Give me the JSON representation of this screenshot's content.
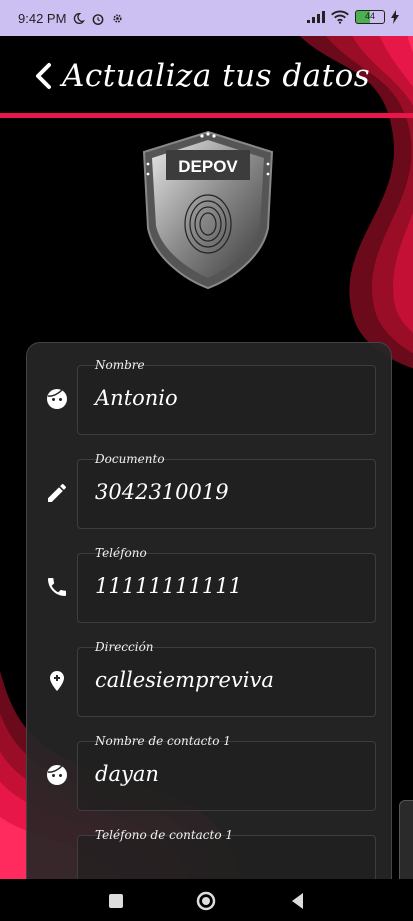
{
  "status_bar": {
    "time": "9:42 PM",
    "icons": [
      "moon-icon",
      "alarm-icon",
      "settings-icon",
      "signal-icon",
      "wifi-icon",
      "battery-icon",
      "charging-icon"
    ],
    "battery_level": "44"
  },
  "header": {
    "title": "Actualiza tus datos",
    "back_icon": "chevron-left-icon"
  },
  "logo": {
    "text": "DEPOV"
  },
  "form": {
    "fields": [
      {
        "label": "Nombre",
        "value": "Antonio",
        "icon": "face-icon"
      },
      {
        "label": "Documento",
        "value": "3042310019",
        "icon": "pencil-icon"
      },
      {
        "label": "Teléfono",
        "value": "11111111111",
        "icon": "phone-icon"
      },
      {
        "label": "Dirección",
        "value": "callesiempreviva",
        "icon": "add-location-icon"
      },
      {
        "label": "Nombre de contacto 1",
        "value": "dayan",
        "icon": "face-icon"
      },
      {
        "label": "Teléfono de contacto 1",
        "value": "",
        "icon": "phone-icon"
      }
    ]
  },
  "nav": {
    "items": [
      "recents-button",
      "home-button",
      "back-button"
    ]
  },
  "colors": {
    "accent": "#e8174a",
    "status_bar": "#ccc0f2",
    "background": "#000000",
    "card": "#262626"
  }
}
